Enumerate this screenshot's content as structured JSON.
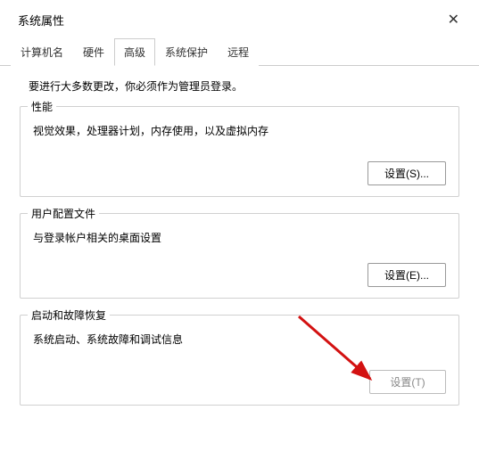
{
  "window": {
    "title": "系统属性",
    "close": "✕"
  },
  "tabs": [
    {
      "label": "计算机名"
    },
    {
      "label": "硬件"
    },
    {
      "label": "高级",
      "active": true
    },
    {
      "label": "系统保护"
    },
    {
      "label": "远程"
    }
  ],
  "intro": "要进行大多数更改，你必须作为管理员登录。",
  "groups": {
    "performance": {
      "legend": "性能",
      "desc": "视觉效果，处理器计划，内存使用，以及虚拟内存",
      "button": "设置(S)..."
    },
    "profiles": {
      "legend": "用户配置文件",
      "desc": "与登录帐户相关的桌面设置",
      "button": "设置(E)..."
    },
    "startup": {
      "legend": "启动和故障恢复",
      "desc": "系统启动、系统故障和调试信息",
      "button": "设置(T)"
    }
  }
}
